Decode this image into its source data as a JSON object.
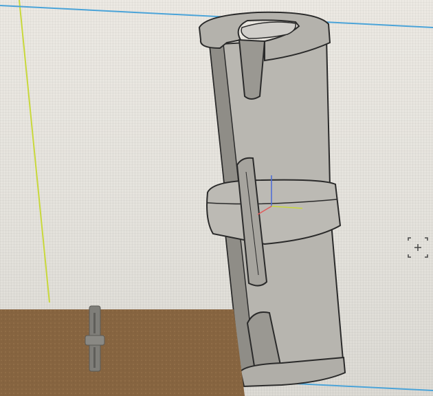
{
  "app": {
    "window_title": "",
    "view": "3d-viewport"
  },
  "viewport": {
    "background_color": "#e8e6e0",
    "axis_colors": {
      "x_axis": "#4aa3d8",
      "y_axis": "#c8d83a",
      "origin_x": "#e05a5a",
      "origin_y": "#6ad05a",
      "origin_z": "#4a6ad8"
    },
    "model": {
      "name": "",
      "body_color": "#b9b7b1",
      "shadow_color": "#8f8d87",
      "edge_color": "#2a2a2a"
    }
  },
  "overlay": {
    "cursor_icon": "crosshair-select-icon"
  },
  "photo_foreground": {
    "table_color": "#8c6a44",
    "printed_part_color": "#7f7e79"
  }
}
